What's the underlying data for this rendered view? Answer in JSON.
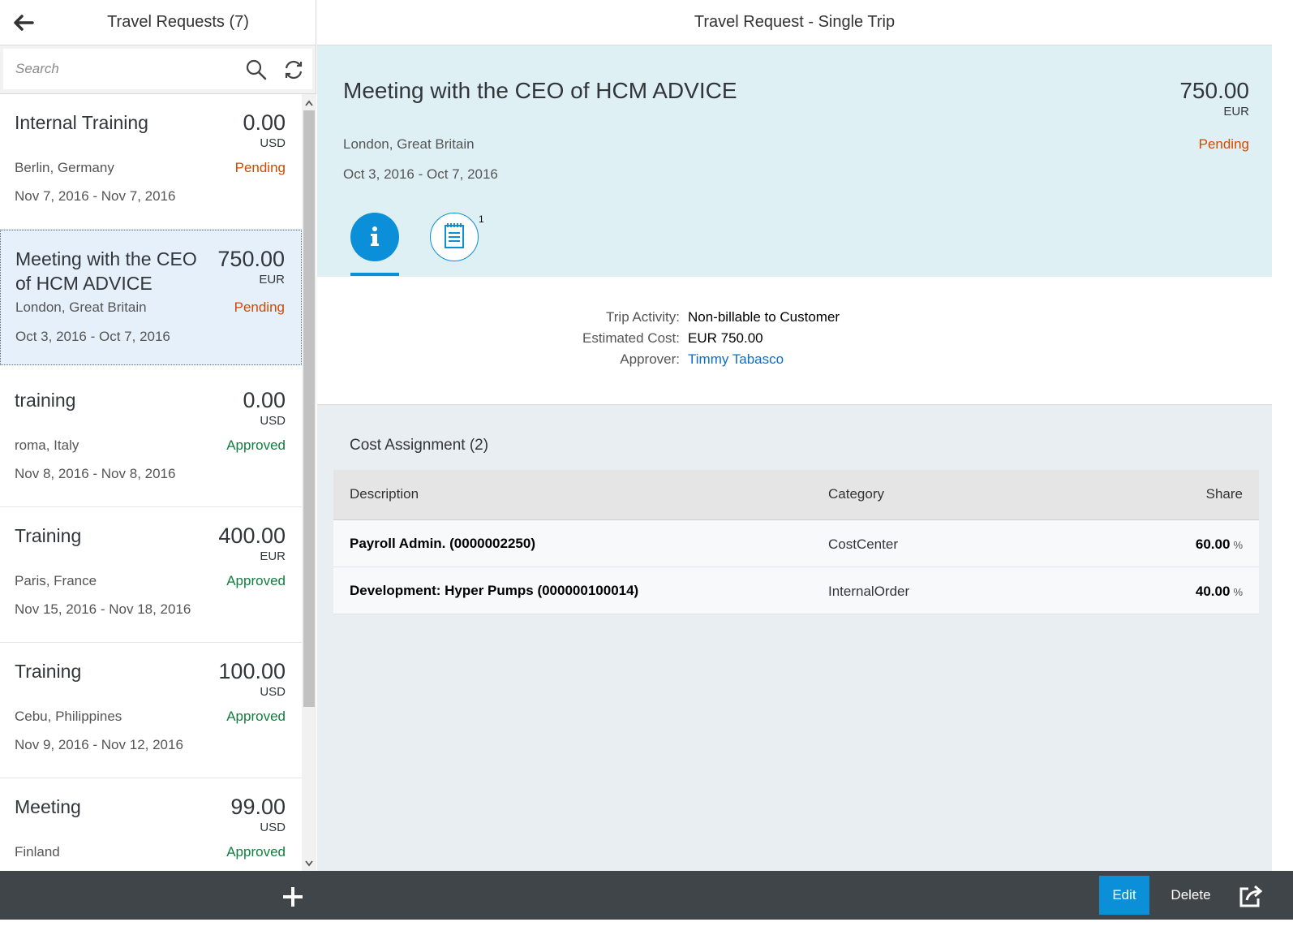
{
  "master": {
    "title": "Travel Requests (7)",
    "search_placeholder": "Search",
    "items": [
      {
        "title": "Internal Training",
        "amount": "0.00",
        "currency": "USD",
        "location": "Berlin, Germany",
        "status": "Pending",
        "dates": "Nov 7, 2016 - Nov 7, 2016"
      },
      {
        "title": "Meeting with the CEO of HCM ADVICE",
        "amount": "750.00",
        "currency": "EUR",
        "location": "London, Great Britain",
        "status": "Pending",
        "dates": "Oct 3, 2016 - Oct 7, 2016"
      },
      {
        "title": "training",
        "amount": "0.00",
        "currency": "USD",
        "location": "roma, Italy",
        "status": "Approved",
        "dates": "Nov 8, 2016 - Nov 8, 2016"
      },
      {
        "title": "Training",
        "amount": "400.00",
        "currency": "EUR",
        "location": "Paris, France",
        "status": "Approved",
        "dates": "Nov 15, 2016 - Nov 18, 2016"
      },
      {
        "title": "Training",
        "amount": "100.00",
        "currency": "USD",
        "location": "Cebu, Philippines",
        "status": "Approved",
        "dates": "Nov 9, 2016 - Nov 12, 2016"
      },
      {
        "title": "Meeting",
        "amount": "99.00",
        "currency": "USD",
        "location": "Finland",
        "status": "Approved",
        "dates": ""
      }
    ]
  },
  "detail": {
    "title": "Travel Request - Single Trip",
    "header": {
      "title": "Meeting with the CEO of HCM ADVICE",
      "amount": "750.00",
      "currency": "EUR",
      "location": "London, Great Britain",
      "status": "Pending",
      "dates": "Oct 3, 2016 - Oct 7, 2016"
    },
    "tabs": {
      "info_icon": "info-icon",
      "notes_icon": "notes-icon",
      "notes_count": "1"
    },
    "info": {
      "trip_activity_label": "Trip Activity:",
      "trip_activity_value": "Non-billable to Customer",
      "estimated_cost_label": "Estimated Cost:",
      "estimated_cost_value": "EUR 750.00",
      "approver_label": "Approver:",
      "approver_value": "Timmy Tabasco"
    },
    "cost_assignment": {
      "title": "Cost Assignment (2)",
      "columns": [
        "Description",
        "Category",
        "Share"
      ],
      "rows": [
        {
          "description": "Payroll Admin. (0000002250)",
          "category": "CostCenter",
          "share": "60.00",
          "unit": "%"
        },
        {
          "description": "Development: Hyper Pumps (000000100014)",
          "category": "InternalOrder",
          "share": "40.00",
          "unit": "%"
        }
      ]
    }
  },
  "footer": {
    "edit_label": "Edit",
    "delete_label": "Delete"
  },
  "colors": {
    "accent": "#0a8fd8",
    "pending": "#d14900",
    "approved": "#107e3e",
    "footer": "#3f4549",
    "header_bg": "#dff0f5"
  }
}
